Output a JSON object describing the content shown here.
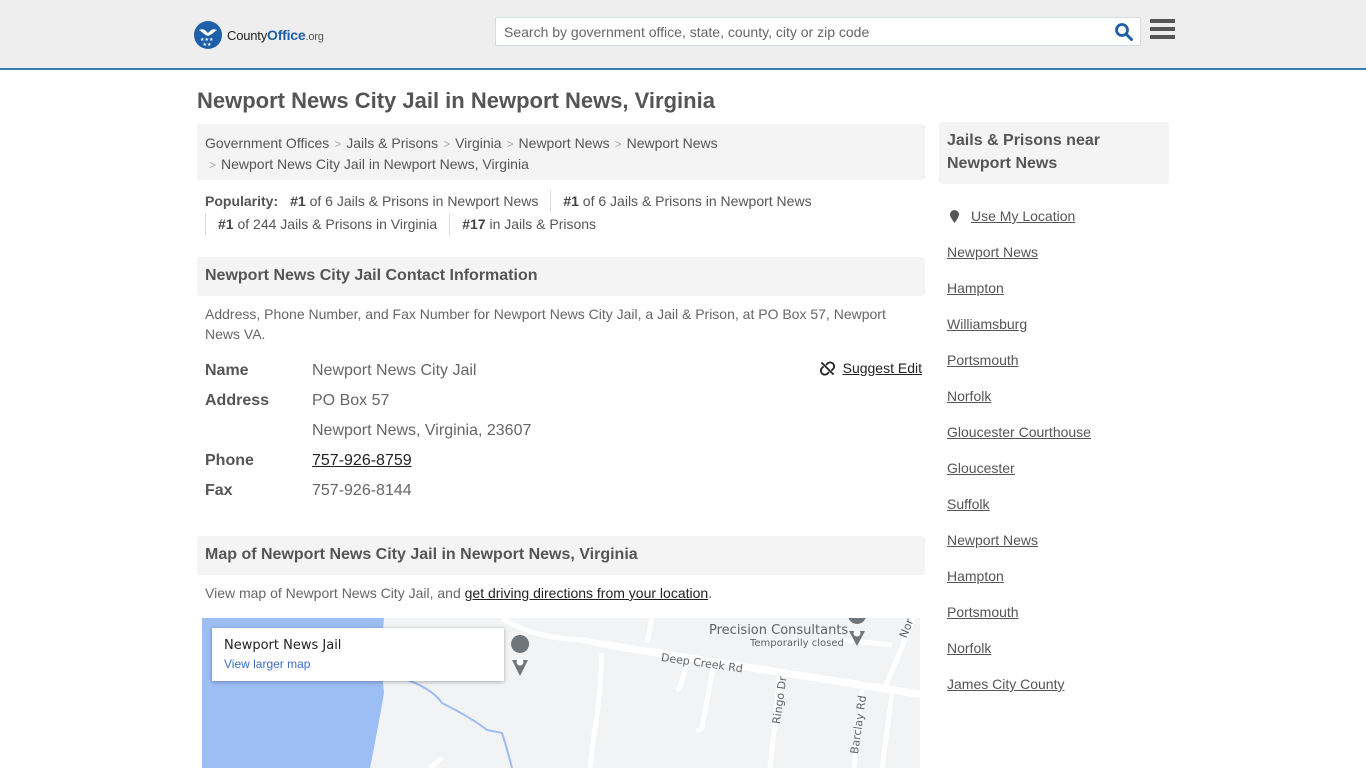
{
  "header": {
    "logo": {
      "prefix": "County",
      "brand": "Office",
      "suffix": ".org"
    },
    "search_placeholder": "Search by government office, state, county, city or zip code",
    "search_value": "",
    "brand_color": "#1d5fa8",
    "accent_bar_color": "#3a7bb0"
  },
  "page_title": "Newport News City Jail in Newport News, Virginia",
  "breadcrumb": {
    "items": [
      "Government Offices",
      "Jails & Prisons",
      "Virginia",
      "Newport News",
      "Newport News"
    ],
    "current": "Newport News City Jail in Newport News, Virginia"
  },
  "popularity": {
    "label": "Popularity:",
    "items": [
      {
        "rank": "#1",
        "text": " of 6 Jails & Prisons in Newport News"
      },
      {
        "rank": "#1",
        "text": " of 6 Jails & Prisons in Newport News"
      },
      {
        "rank": "#1",
        "text": " of 244 Jails & Prisons in Virginia"
      },
      {
        "rank": "#17",
        "text": " in Jails & Prisons"
      }
    ]
  },
  "contact": {
    "heading": "Newport News City Jail Contact Information",
    "description": "Address, Phone Number, and Fax Number for Newport News City Jail, a Jail & Prison, at PO Box 57, Newport News VA.",
    "suggest_edit": "Suggest Edit",
    "fields": {
      "name_label": "Name",
      "name": "Newport News City Jail",
      "address_label": "Address",
      "address_line1": "PO Box 57",
      "address_line2": "Newport News, Virginia, 23607",
      "phone_label": "Phone",
      "phone": "757-926-8759",
      "fax_label": "Fax",
      "fax": "757-926-8144"
    }
  },
  "map_section": {
    "heading": "Map of Newport News City Jail in Newport News, Virginia",
    "desc_prefix": "View map of Newport News City Jail, and ",
    "desc_link": "get driving directions from your location",
    "desc_suffix": ".",
    "card_title": "Newport News Jail",
    "card_link": "View larger map",
    "labels": {
      "poi_name": "Precision Consultants",
      "poi_status": "Temporarily closed",
      "road1": "Deep Creek Rd",
      "road2": "Ringo Dr",
      "road3": "Barclay Rd",
      "road4": "Nor"
    }
  },
  "sidebar": {
    "heading": "Jails & Prisons near Newport News",
    "use_location": "Use My Location",
    "items": [
      "Newport News",
      "Hampton",
      "Williamsburg",
      "Portsmouth",
      "Norfolk",
      "Gloucester Courthouse",
      "Gloucester",
      "Suffolk",
      "Newport News",
      "Hampton",
      "Portsmouth",
      "Norfolk",
      "James City County"
    ]
  }
}
